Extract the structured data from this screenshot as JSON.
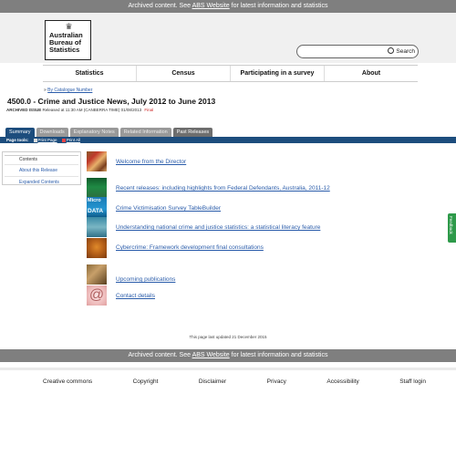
{
  "archive_notice": {
    "prefix": "Archived content. See ",
    "link": "ABS Website",
    "suffix": " for latest information and statistics"
  },
  "logo": {
    "line1": "Australian",
    "line2": "Bureau of",
    "line3": "Statistics"
  },
  "search": {
    "placeholder": "",
    "button_label": "Search"
  },
  "nav": [
    "Statistics",
    "Census",
    "Participating in a survey",
    "About"
  ],
  "breadcrumb": {
    "prefix": "» ",
    "link": "By Catalogue Number"
  },
  "page": {
    "title": "4500.0 - Crime and Justice News, July 2012 to June 2013",
    "archived_label": "ARCHIVED ISSUE",
    "released_text": " Released at 11:30 AM (CANBERRA TIME) 01/08/2013 ",
    "final_label": "Final"
  },
  "tabs": [
    "Summary",
    "Downloads",
    "Explanatory Notes",
    "Related Information",
    "Past Releases"
  ],
  "page_tools": {
    "label": "Page tools:",
    "print_page": "Print Page",
    "print_all": "Print All"
  },
  "side_panel": {
    "items": [
      "Contents",
      "About this Release",
      "Expanded Contents"
    ]
  },
  "entries": [
    "Welcome from the Director",
    "Recent releases: including highlights from Federal Defendants, Australia, 2011-12",
    "Crime Victimisation Survey TableBuilder",
    "Understanding national crime and justice statistics: a statistical literacy feature",
    "Cybercrime: Framework development final consultations",
    "Upcoming publications",
    "Contact details"
  ],
  "thumb_text": {
    "micro": "Micro",
    "data": "DATA"
  },
  "updated": "This page last updated 21 December 2015",
  "footer": [
    "Creative commons",
    "Copyright",
    "Disclaimer",
    "Privacy",
    "Accessibility",
    "Staff login"
  ],
  "feedback_label": "Feedback",
  "colors": {
    "nav_blue": "#1d4d7d",
    "archive_gray": "#7f7f7f",
    "link_blue": "#2a5caa",
    "final_red": "#cc2222"
  }
}
